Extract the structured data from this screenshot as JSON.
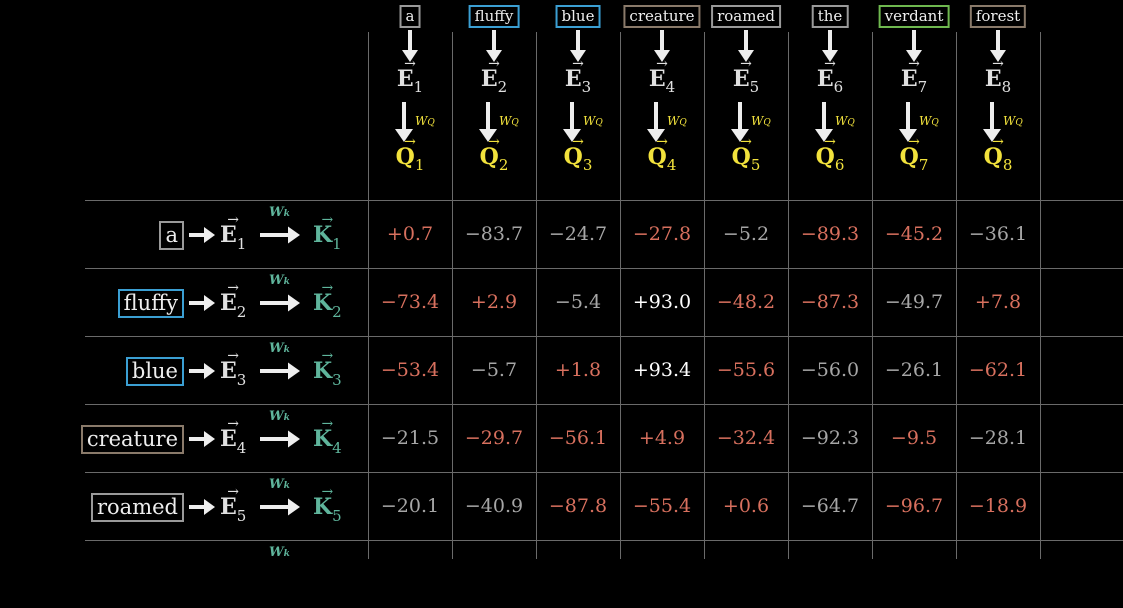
{
  "colors": {
    "positive": "#d8705e",
    "negative_light": "#a6a6a6",
    "highlight": "#ffffff",
    "query": "#f2e23c",
    "key": "#5fb59c"
  },
  "columns": [
    {
      "token": "a",
      "border": "#9a9a9a",
      "e_sub": "1",
      "q_sub": "1"
    },
    {
      "token": "fluffy",
      "border": "#3b9fd3",
      "e_sub": "2",
      "q_sub": "2"
    },
    {
      "token": "blue",
      "border": "#3b9fd3",
      "e_sub": "3",
      "q_sub": "3"
    },
    {
      "token": "creature",
      "border": "#8a7a6a",
      "e_sub": "4",
      "q_sub": "4"
    },
    {
      "token": "roamed",
      "border": "#9a9a9a",
      "e_sub": "5",
      "q_sub": "5"
    },
    {
      "token": "the",
      "border": "#9a9a9a",
      "e_sub": "6",
      "q_sub": "6"
    },
    {
      "token": "verdant",
      "border": "#6fb84f",
      "e_sub": "7",
      "q_sub": "7"
    },
    {
      "token": "forest",
      "border": "#8a7a6a",
      "e_sub": "8",
      "q_sub": "8"
    }
  ],
  "labels": {
    "e_symbol": "E",
    "q_symbol": "Q",
    "k_symbol": "K",
    "vec_hat": "→",
    "wq": "W",
    "wq_sub": "Q",
    "wk": "W",
    "wk_sub": "k"
  },
  "rows": [
    {
      "token": "a",
      "border": "#9a9a9a",
      "sub": "1",
      "cells": [
        {
          "text": "+0.7",
          "tone": "positive"
        },
        {
          "text": "−83.7",
          "tone": "negative_light"
        },
        {
          "text": "−24.7",
          "tone": "negative_light"
        },
        {
          "text": "−27.8",
          "tone": "positive"
        },
        {
          "text": "−5.2",
          "tone": "negative_light"
        },
        {
          "text": "−89.3",
          "tone": "positive"
        },
        {
          "text": "−45.2",
          "tone": "positive"
        },
        {
          "text": "−36.1",
          "tone": "negative_light"
        }
      ]
    },
    {
      "token": "fluffy",
      "border": "#3b9fd3",
      "sub": "2",
      "cells": [
        {
          "text": "−73.4",
          "tone": "positive"
        },
        {
          "text": "+2.9",
          "tone": "positive"
        },
        {
          "text": "−5.4",
          "tone": "negative_light"
        },
        {
          "text": "+93.0",
          "tone": "highlight"
        },
        {
          "text": "−48.2",
          "tone": "positive"
        },
        {
          "text": "−87.3",
          "tone": "positive"
        },
        {
          "text": "−49.7",
          "tone": "negative_light"
        },
        {
          "text": "+7.8",
          "tone": "positive"
        }
      ]
    },
    {
      "token": "blue",
      "border": "#3b9fd3",
      "sub": "3",
      "cells": [
        {
          "text": "−53.4",
          "tone": "positive"
        },
        {
          "text": "−5.7",
          "tone": "negative_light"
        },
        {
          "text": "+1.8",
          "tone": "positive"
        },
        {
          "text": "+93.4",
          "tone": "highlight"
        },
        {
          "text": "−55.6",
          "tone": "positive"
        },
        {
          "text": "−56.0",
          "tone": "negative_light"
        },
        {
          "text": "−26.1",
          "tone": "negative_light"
        },
        {
          "text": "−62.1",
          "tone": "positive"
        }
      ]
    },
    {
      "token": "creature",
      "border": "#8a7a6a",
      "sub": "4",
      "cells": [
        {
          "text": "−21.5",
          "tone": "negative_light"
        },
        {
          "text": "−29.7",
          "tone": "positive"
        },
        {
          "text": "−56.1",
          "tone": "positive"
        },
        {
          "text": "+4.9",
          "tone": "positive"
        },
        {
          "text": "−32.4",
          "tone": "positive"
        },
        {
          "text": "−92.3",
          "tone": "negative_light"
        },
        {
          "text": "−9.5",
          "tone": "positive"
        },
        {
          "text": "−28.1",
          "tone": "negative_light"
        }
      ]
    },
    {
      "token": "roamed",
      "border": "#9a9a9a",
      "sub": "5",
      "cells": [
        {
          "text": "−20.1",
          "tone": "negative_light"
        },
        {
          "text": "−40.9",
          "tone": "negative_light"
        },
        {
          "text": "−87.8",
          "tone": "positive"
        },
        {
          "text": "−55.4",
          "tone": "positive"
        },
        {
          "text": "+0.6",
          "tone": "positive"
        },
        {
          "text": "−64.7",
          "tone": "negative_light"
        },
        {
          "text": "−96.7",
          "tone": "positive"
        },
        {
          "text": "−18.9",
          "tone": "positive"
        }
      ]
    },
    {
      "partial": true
    }
  ]
}
